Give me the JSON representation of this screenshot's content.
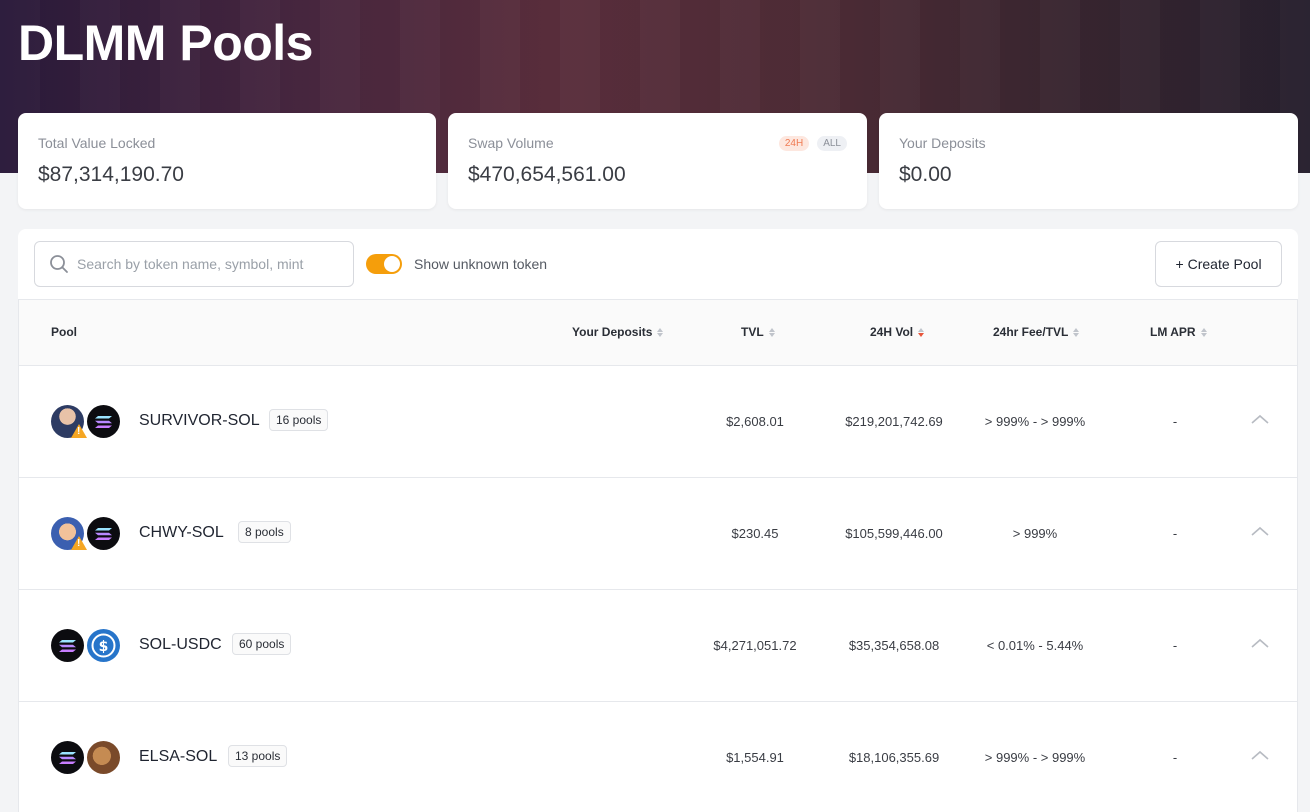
{
  "header": {
    "title": "DLMM Pools"
  },
  "stats": [
    {
      "label": "Total Value Locked",
      "value": "$87,314,190.70"
    },
    {
      "label": "Swap Volume",
      "value": "$470,654,561.00",
      "tabs": [
        "24H",
        "ALL"
      ]
    },
    {
      "label": "Your Deposits",
      "value": "$0.00"
    }
  ],
  "toolbar": {
    "search_placeholder": "Search by token name, symbol, mint",
    "toggle_label": "Show unknown token",
    "create_label": "Create Pool",
    "create_icon": "+"
  },
  "table": {
    "columns": [
      "Pool",
      "Your Deposits",
      "TVL",
      "24H Vol",
      "24hr Fee/TVL",
      "LM APR"
    ],
    "rows": [
      {
        "name": "SURVIVOR-SOL",
        "badge": "16 pools",
        "deposits": "",
        "tvl": "$2,608.01",
        "vol": "$219,201,742.69",
        "fee": "> 999% - > 999%",
        "apr": "-"
      },
      {
        "name": "CHWY-SOL",
        "badge": "8 pools",
        "deposits": "",
        "tvl": "$230.45",
        "vol": "$105,599,446.00",
        "fee": "> 999%",
        "apr": "-"
      },
      {
        "name": "SOL-USDC",
        "badge": "60 pools",
        "deposits": "",
        "tvl": "$4,271,051.72",
        "vol": "$35,354,658.08",
        "fee": "< 0.01% - 5.44%",
        "apr": "-"
      },
      {
        "name": "ELSA-SOL",
        "badge": "13 pools",
        "deposits": "",
        "tvl": "$1,554.91",
        "vol": "$18,106,355.69",
        "fee": "> 999% - > 999%",
        "apr": "-"
      }
    ]
  },
  "colors": {
    "accent": "#f59e0b",
    "sort_active": "#e8553a",
    "badge_24h": "#f07a52"
  }
}
